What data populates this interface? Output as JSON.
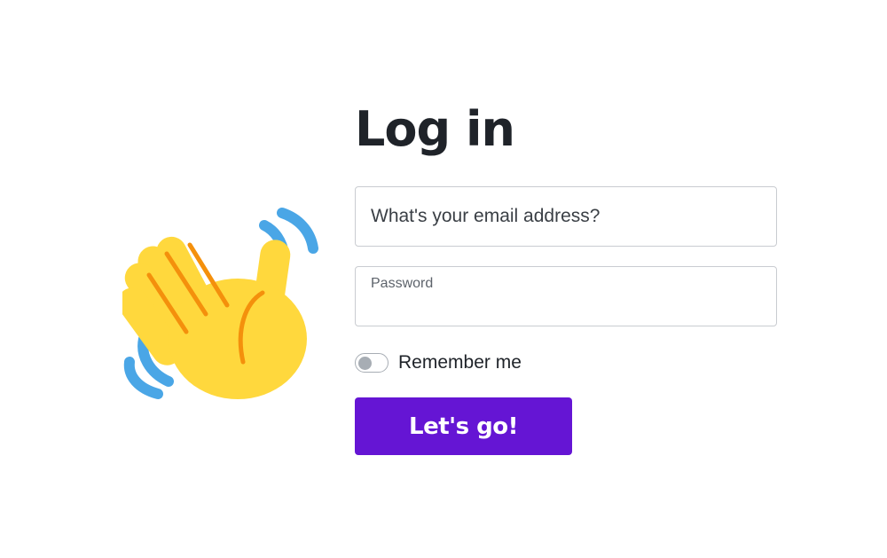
{
  "header": {
    "title": "Log in"
  },
  "form": {
    "email": {
      "placeholder": "What's your email address?",
      "value": ""
    },
    "password": {
      "label": "Password",
      "value": ""
    },
    "remember": {
      "label": "Remember me",
      "checked": false
    },
    "submit_label": "Let's go!"
  },
  "illustration": {
    "icon": "waving-hand-icon"
  },
  "colors": {
    "accent": "#6515d4",
    "hand": "#ffd83d",
    "hand_lines": "#f4900c",
    "motion_lines": "#4aa6e6",
    "text": "#1f2329",
    "border": "#c9ccd1",
    "toggle": "#a7adb4"
  }
}
